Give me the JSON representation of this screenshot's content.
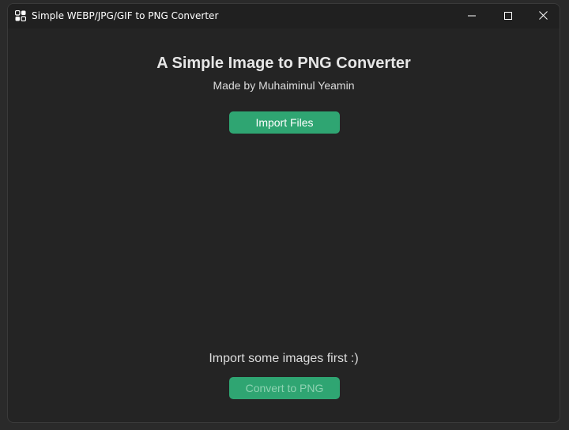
{
  "window": {
    "title": "Simple WEBP/JPG/GIF to PNG Converter",
    "icons": {
      "app": "app-icon",
      "minimize": "minimize-icon",
      "maximize": "maximize-icon",
      "close": "close-icon"
    }
  },
  "main": {
    "heading": "A Simple Image to PNG Converter",
    "subtitle": "Made by Muhaiminul Yeamin",
    "import_button_label": "Import Files",
    "status_text": "Import some images first :)",
    "convert_button_label": "Convert to PNG"
  },
  "colors": {
    "accent": "#2fa572",
    "background": "#242424",
    "titlebar": "#202020",
    "disabled_text": "#8fd2b2"
  }
}
